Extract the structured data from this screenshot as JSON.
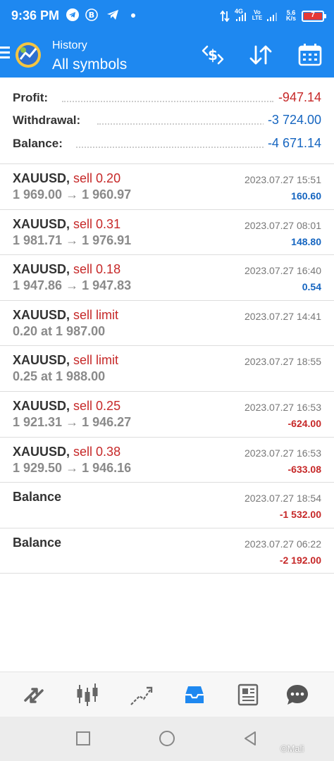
{
  "status_bar": {
    "time": "9:36 PM",
    "net1": "4G",
    "net2": "Vo LTE",
    "speed_top": "5.6",
    "speed_bottom": "K/s",
    "battery": "7"
  },
  "header": {
    "title": "History",
    "subtitle": "All symbols",
    "icons": [
      "menu-icon",
      "app-logo",
      "currency-swap-icon",
      "sort-icon",
      "calendar-icon"
    ]
  },
  "summary": {
    "profit_label": "Profit:",
    "profit_value": "-947.14",
    "withdrawal_label": "Withdrawal:",
    "withdrawal_value": "-3 724.00",
    "balance_label": "Balance:",
    "balance_value": "-4 671.14",
    "colors": {
      "negative": "#c62828",
      "blue": "#1565c0"
    }
  },
  "rows": [
    {
      "symbol": "XAUUSD,",
      "type": "sell 0.20",
      "prices": "1 969.00 → 1 960.97",
      "date": "2023.07.27 15:51",
      "profit": "160.60"
    },
    {
      "symbol": "XAUUSD,",
      "type": "sell 0.31",
      "prices": "1 981.71 → 1 976.91",
      "date": "2023.07.27 08:01",
      "profit": "148.80"
    },
    {
      "symbol": "XAUUSD,",
      "type": "sell 0.18",
      "prices": "1 947.86 → 1 947.83",
      "date": "2023.07.27 16:40",
      "profit": "0.54"
    },
    {
      "symbol": "XAUUSD,",
      "type": "sell limit",
      "prices": "0.20 at 1 987.00",
      "date": "2023.07.27 14:41",
      "profit": ""
    },
    {
      "symbol": "XAUUSD,",
      "type": "sell limit",
      "prices": "0.25 at 1 988.00",
      "date": "2023.07.27 18:55",
      "profit": ""
    },
    {
      "symbol": "XAUUSD,",
      "type": "sell 0.25",
      "prices": "1 921.31 → 1 946.27",
      "date": "2023.07.27 16:53",
      "profit": "-624.00"
    },
    {
      "symbol": "XAUUSD,",
      "type": "sell 0.38",
      "prices": "1 929.50 → 1 946.16",
      "date": "2023.07.27 16:53",
      "profit": "-633.08"
    },
    {
      "balance": "Balance",
      "date": "2023.07.27 18:54",
      "profit": "-1 532.00"
    },
    {
      "balance": "Balance",
      "date": "2023.07.27 06:22",
      "profit": "-2 192.00"
    }
  ],
  "bottom_nav": [
    "quotes-icon",
    "chart-icon",
    "trade-icon",
    "history-icon",
    "news-icon",
    "chat-icon"
  ],
  "watermark": "©Mali"
}
